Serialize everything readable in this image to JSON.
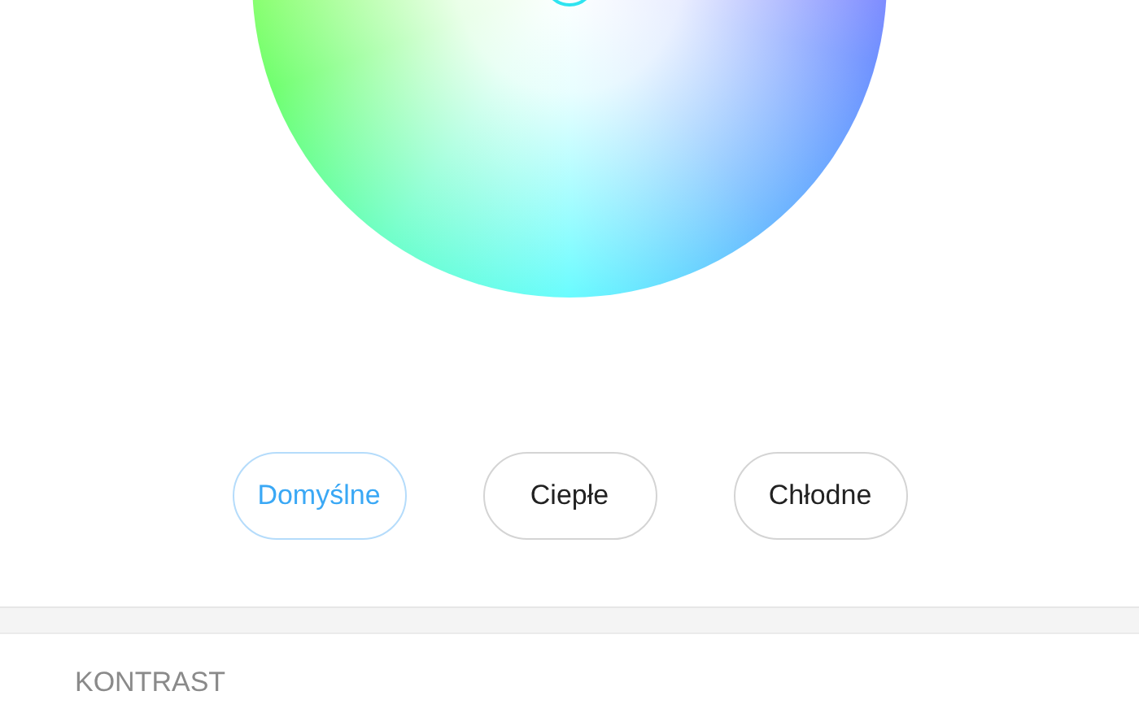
{
  "presets": [
    {
      "label": "Domyślne",
      "selected": true
    },
    {
      "label": "Ciepłe",
      "selected": false
    },
    {
      "label": "Chłodne",
      "selected": false
    }
  ],
  "section_header": "KONTRAST"
}
